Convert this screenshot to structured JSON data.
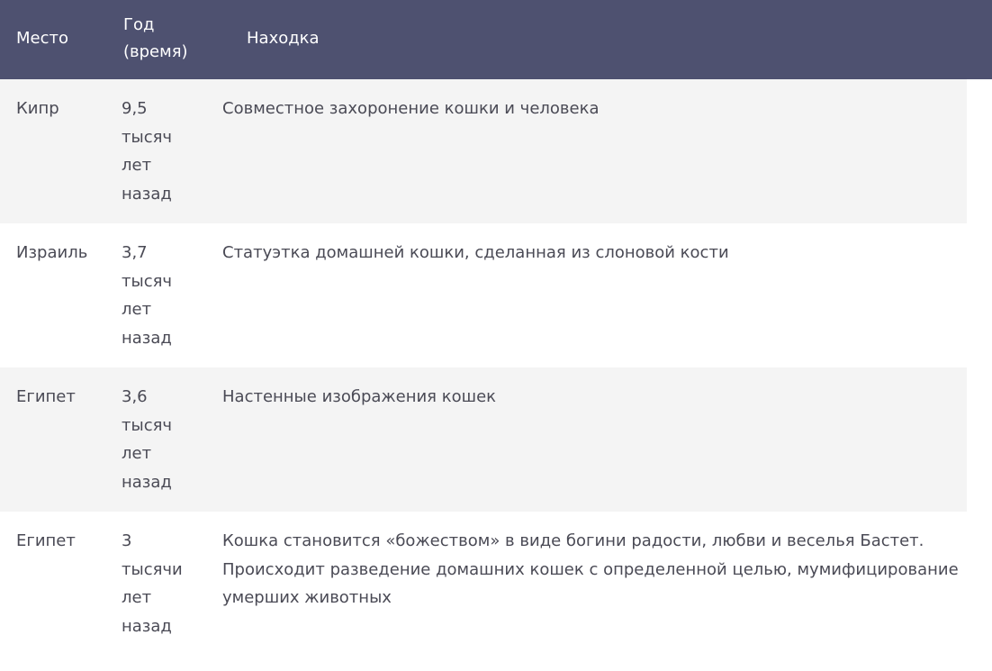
{
  "table": {
    "headers": {
      "place": "Место",
      "year": "Год (время)",
      "find": "Находка"
    },
    "rows": [
      {
        "place": "Кипр",
        "year": "9,5 тысяч лет назад",
        "find": "Совместное захоронение кошки и человека"
      },
      {
        "place": "Израиль",
        "year": "3,7 тысяч лет назад",
        "find": "Статуэтка домашней кошки, сделанная из слоновой кости"
      },
      {
        "place": "Египет",
        "year": "3,6 тысяч лет назад",
        "find": "Настенные изображения кошек"
      },
      {
        "place": "Египет",
        "year": "3 тысячи лет назад",
        "find": "Кошка становится «божеством» в виде богини радости, любви и веселья Бастет. Происходит разведение домашних кошек с определенной целью, мумифицирование умерших животных"
      }
    ]
  },
  "colors": {
    "header_bg": "#4e5170",
    "header_text": "#ffffff",
    "row_shade": "#f4f4f4",
    "body_text": "#4a4a55"
  }
}
